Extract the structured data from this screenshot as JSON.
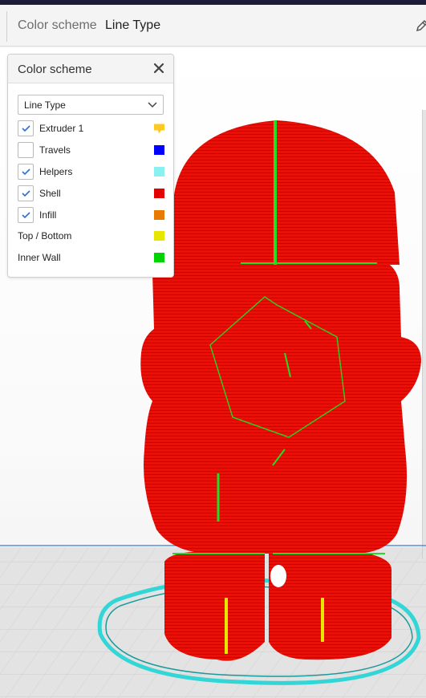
{
  "header": {
    "label": "Color scheme",
    "value": "Line Type"
  },
  "panel": {
    "title": "Color scheme",
    "dropdown_value": "Line Type",
    "items": [
      {
        "label": "Extruder 1",
        "checked": true,
        "color": "#ffc924",
        "swatch": "extruder-swatch"
      },
      {
        "label": "Travels",
        "checked": false,
        "color": "#0000ff",
        "swatch": "square"
      },
      {
        "label": "Helpers",
        "checked": true,
        "color": "#8af0f0",
        "swatch": "square"
      },
      {
        "label": "Shell",
        "checked": true,
        "color": "#e20000",
        "swatch": "square"
      },
      {
        "label": "Infill",
        "checked": true,
        "color": "#e87a00",
        "swatch": "square"
      }
    ],
    "legend": [
      {
        "label": "Top / Bottom",
        "color": "#e6e600"
      },
      {
        "label": "Inner Wall",
        "color": "#00d400"
      }
    ]
  },
  "colors": {
    "shell": "#e8110a",
    "inner_wall": "#22dd22",
    "top_bottom": "#e6e600",
    "helpers": "#33d6d6",
    "accent": "#1c1c3a"
  }
}
